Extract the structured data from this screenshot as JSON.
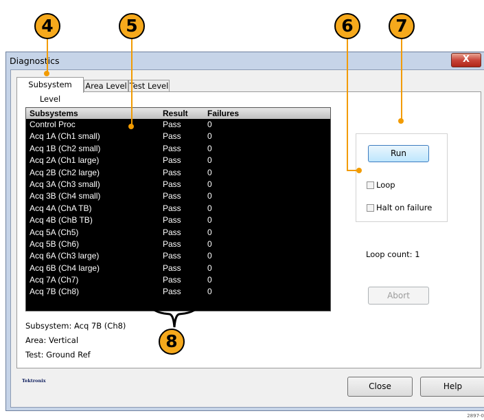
{
  "window": {
    "title": "Diagnostics",
    "close_glyph": "X"
  },
  "tabs": [
    {
      "label": "Subsystem Level",
      "active": true
    },
    {
      "label": "Area Level",
      "active": false
    },
    {
      "label": "Test Level",
      "active": false
    }
  ],
  "table": {
    "columns": [
      "Subsystems",
      "Result",
      "Failures"
    ],
    "rows": [
      [
        "Control Proc",
        "Pass",
        "0"
      ],
      [
        "Acq 1A (Ch1 small)",
        "Pass",
        "0"
      ],
      [
        "Acq 1B (Ch2 small)",
        "Pass",
        "0"
      ],
      [
        "Acq 2A (Ch1 large)",
        "Pass",
        "0"
      ],
      [
        "Acq 2B (Ch2 large)",
        "Pass",
        "0"
      ],
      [
        "Acq 3A (Ch3 small)",
        "Pass",
        "0"
      ],
      [
        "Acq 3B (Ch4 small)",
        "Pass",
        "0"
      ],
      [
        "Acq 4A (ChA TB)",
        "Pass",
        "0"
      ],
      [
        "Acq 4B (ChB TB)",
        "Pass",
        "0"
      ],
      [
        "Acq 5A (Ch5)",
        "Pass",
        "0"
      ],
      [
        "Acq 5B (Ch6)",
        "Pass",
        "0"
      ],
      [
        "Acq 6A (Ch3 large)",
        "Pass",
        "0"
      ],
      [
        "Acq 6B (Ch4 large)",
        "Pass",
        "0"
      ],
      [
        "Acq 7A (Ch7)",
        "Pass",
        "0"
      ],
      [
        "Acq 7B (Ch8)",
        "Pass",
        "0"
      ]
    ]
  },
  "details": {
    "subsystem": "Subsystem: Acq 7B (Ch8)",
    "area": "Area: Vertical",
    "test": "Test: Ground Ref"
  },
  "controls": {
    "run_label": "Run",
    "loop_label": "Loop",
    "loop_checked": false,
    "halt_label": "Halt on failure",
    "halt_checked": false,
    "loop_count": "Loop count: 1",
    "abort_label": "Abort"
  },
  "footer": {
    "logo": "Tektronix",
    "close_label": "Close",
    "help_label": "Help"
  },
  "callouts": [
    "4",
    "5",
    "6",
    "7",
    "8"
  ],
  "figure_id": "2897-0",
  "colors": {
    "callout": "#f6a91c",
    "leader": "#f29b00",
    "list_bg": "#000000"
  }
}
